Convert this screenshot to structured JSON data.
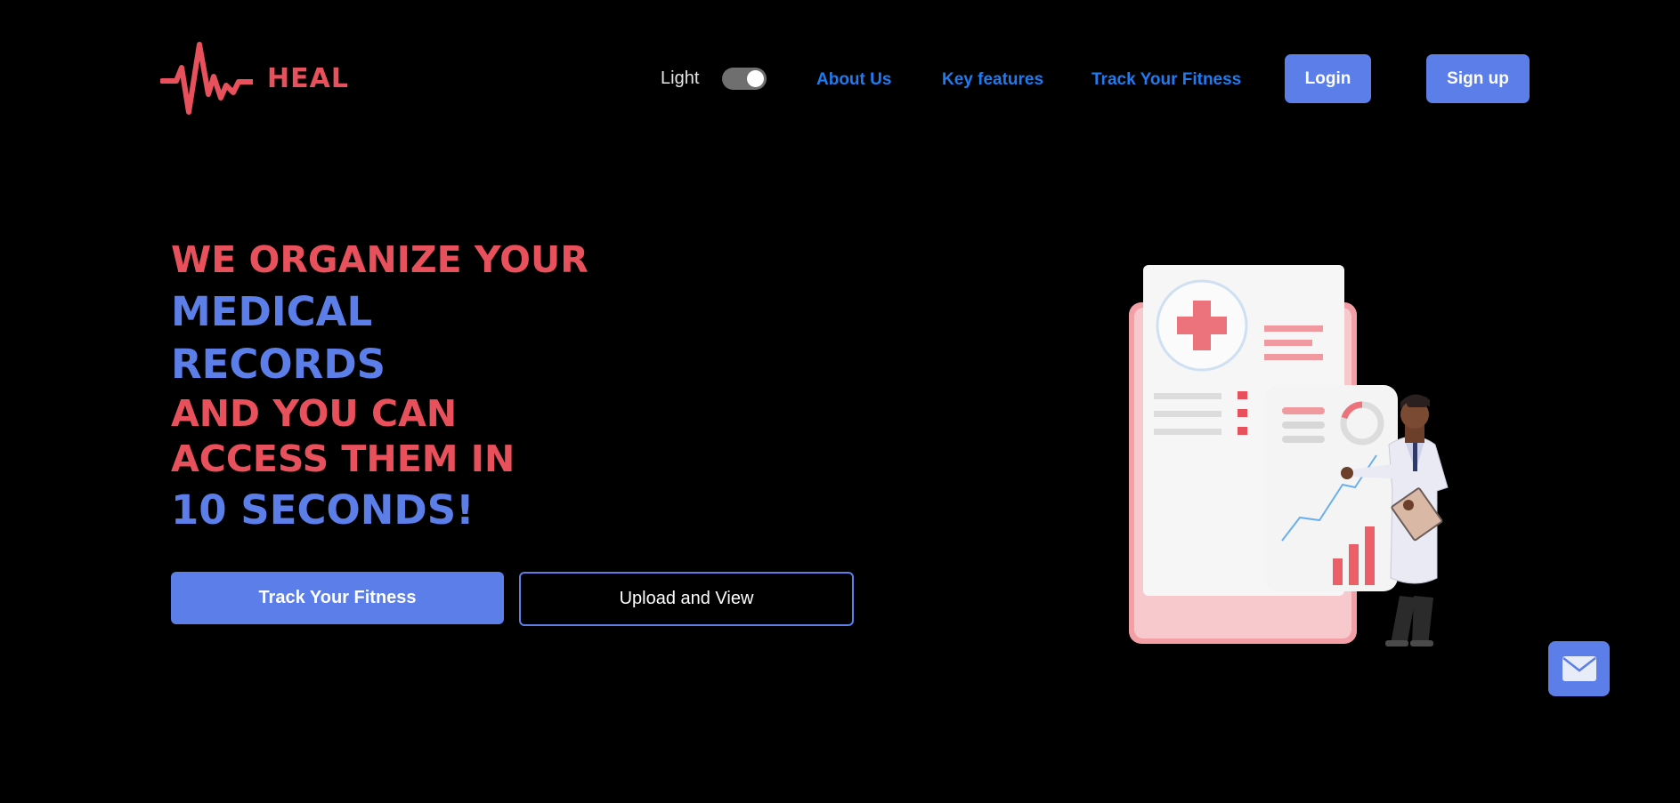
{
  "brand": {
    "name": "HEAL",
    "logo_icon": "heartbeat-pulse-icon",
    "color": "#e8505b"
  },
  "nav": {
    "theme_toggle_label": "Light",
    "theme_toggle_state": "on",
    "links": [
      "About Us",
      "Key features",
      "Track Your Fitness"
    ],
    "login_label": "Login",
    "signup_label": "Sign up",
    "link_color": "#1e7bf2",
    "button_color": "#5b7ee8"
  },
  "hero": {
    "line1": "WE ORGANIZE YOUR",
    "line2": "MEDICAL",
    "line3": "RECORDS",
    "line4": "AND YOU CAN",
    "line5": "ACCESS THEM IN",
    "line6": "10 SECONDS!",
    "accent_red": "#e8505b",
    "accent_blue": "#5b7ee8"
  },
  "actions": {
    "primary_label": "Track Your Fitness",
    "secondary_label": "Upload and View"
  },
  "illustration": {
    "icon": "doctor-medical-records-illustration"
  },
  "floating": {
    "mail_icon": "envelope-icon"
  }
}
